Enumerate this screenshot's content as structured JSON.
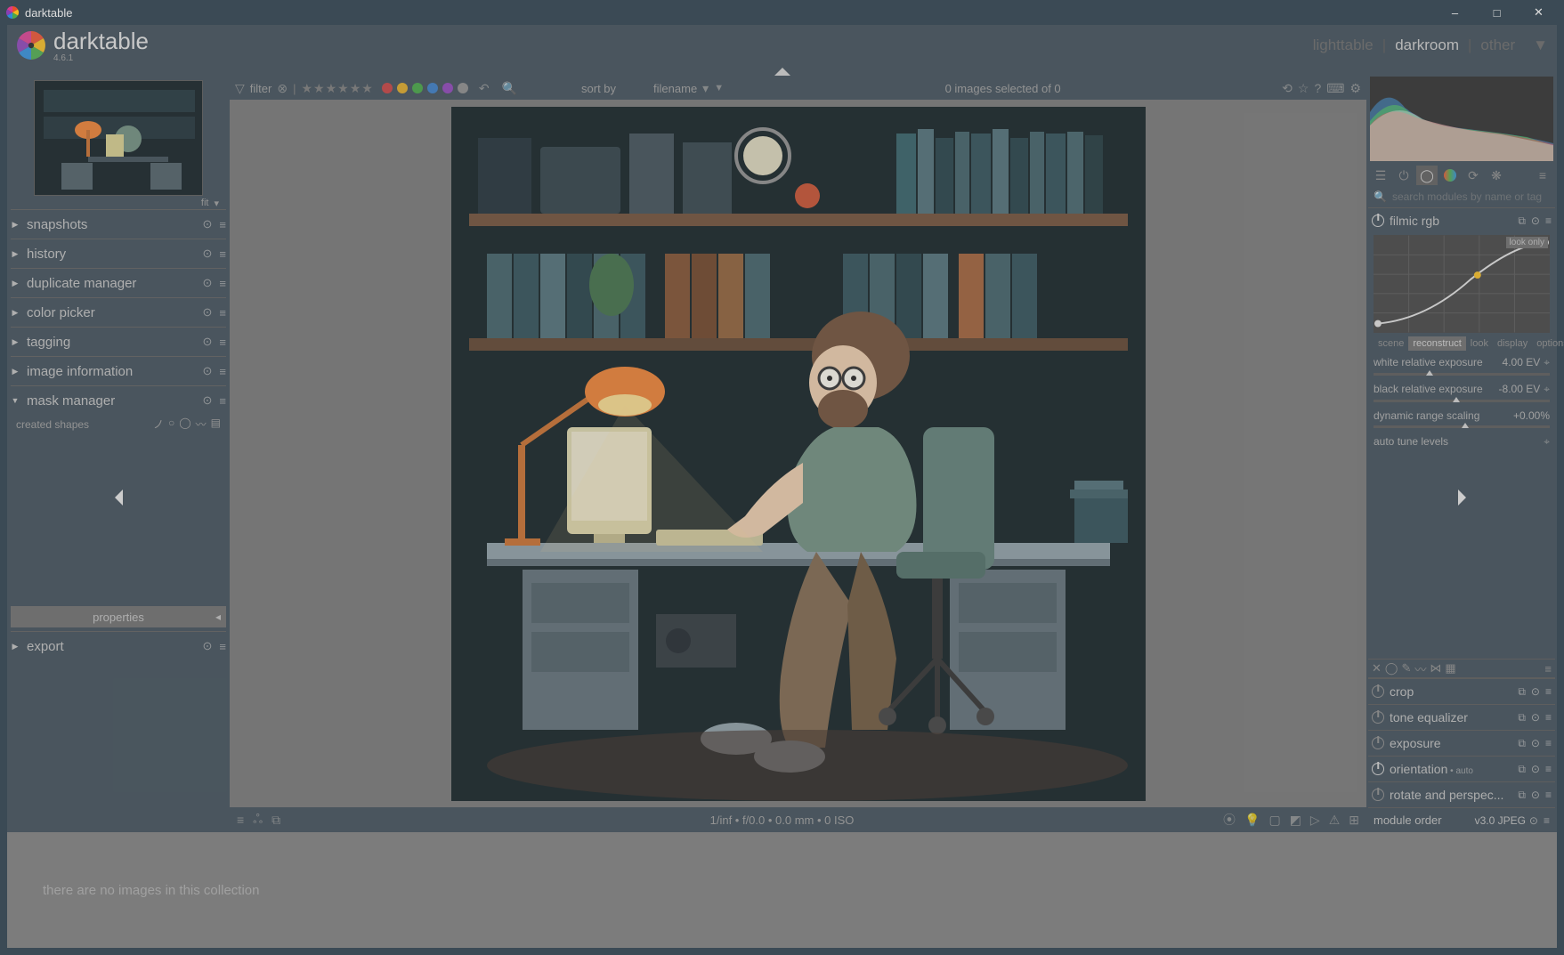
{
  "window": {
    "title": "darktable"
  },
  "brand": {
    "name": "darktable",
    "version": "4.6.1"
  },
  "views": {
    "lighttable": "lighttable",
    "darkroom": "darkroom",
    "other": "other"
  },
  "toolbar": {
    "filter_label": "filter",
    "sortby_label": "sort by",
    "sort_value": "filename",
    "selection": "0 images selected of 0",
    "dot_colors": [
      "#c23b3b",
      "#d9a521",
      "#3fa03f",
      "#3478c2",
      "#8a3fb5",
      "#888888"
    ]
  },
  "left_fit": "fit",
  "left_panels": [
    {
      "label": "snapshots",
      "expanded": false
    },
    {
      "label": "history",
      "expanded": false
    },
    {
      "label": "duplicate manager",
      "expanded": false
    },
    {
      "label": "color picker",
      "expanded": false
    },
    {
      "label": "tagging",
      "expanded": false
    },
    {
      "label": "image information",
      "expanded": false
    },
    {
      "label": "mask manager",
      "expanded": true
    }
  ],
  "mask": {
    "created_shapes": "created shapes"
  },
  "properties_label": "properties",
  "export_label": "export",
  "search_placeholder": "search modules by name or tag",
  "filmic": {
    "title": "filmic rgb",
    "look_only": "look only",
    "tabs": [
      "scene",
      "reconstruct",
      "look",
      "display",
      "options"
    ],
    "white_label": "white relative exposure",
    "white_value": "4.00 EV",
    "black_label": "black relative exposure",
    "black_value": "-8.00 EV",
    "range_label": "dynamic range scaling",
    "range_value": "+0.00%",
    "auto_label": "auto tune levels"
  },
  "modules": [
    {
      "label": "crop",
      "on": false
    },
    {
      "label": "tone equalizer",
      "on": false
    },
    {
      "label": "exposure",
      "on": false
    },
    {
      "label": "orientation",
      "on": true,
      "extra": "• auto"
    },
    {
      "label": "rotate and perspec...",
      "on": false
    }
  ],
  "module_order": {
    "label": "module order",
    "value": "v3.0 JPEG"
  },
  "bottom": {
    "info": "1/inf • f/0.0 • 0.0 mm • 0 ISO"
  },
  "filmstrip": {
    "empty": "there are no images in this collection"
  }
}
